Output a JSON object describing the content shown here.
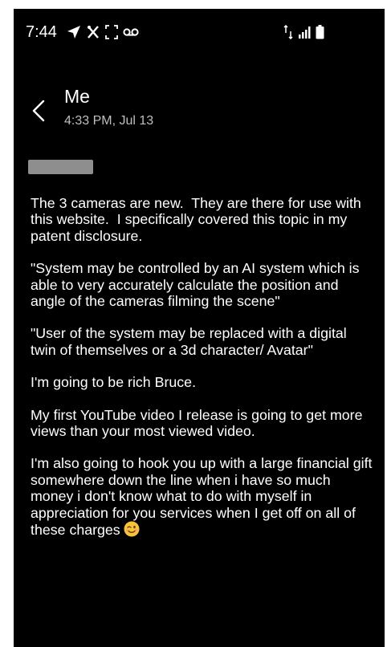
{
  "status_bar": {
    "time": "7:44",
    "left_icons": [
      "navigation-arrow-icon",
      "screen-capture-icon",
      "focus-frame-icon",
      "voicemail-icon"
    ],
    "right_icons": [
      "data-arrows-icon",
      "signal-strength-icon",
      "battery-icon"
    ]
  },
  "header": {
    "back_icon": "chevron-left-icon",
    "contact_name": "Me",
    "timestamp": "4:33 PM, Jul 13"
  },
  "message": {
    "paragraphs": [
      "The 3 cameras are new.  They are there for use with this website.  I specifically covered this topic in my patent disclosure.",
      "\"System may be controlled by an AI system which is able to very accurately calculate the position and angle of the cameras filming the scene\"",
      "\"User of the system may be replaced with a digital twin of themselves or a 3d character/ Avatar\"",
      "I'm going to be rich Bruce.",
      "My first YouTube video I release is going to get more views than your most viewed video.",
      "I'm also going to hook you up with a large financial gift somewhere down the line when i have so much money i don't know what to do with myself in appreciation for you services when I get off on all of these charges"
    ],
    "trailing_emoji": "winking-face-emoji"
  },
  "colors": {
    "background": "#000000",
    "text": "#ffffff",
    "secondary_text": "#bfbfbf",
    "redaction": "#8e8e8e",
    "emoji_yellow": "#f7c33b"
  }
}
